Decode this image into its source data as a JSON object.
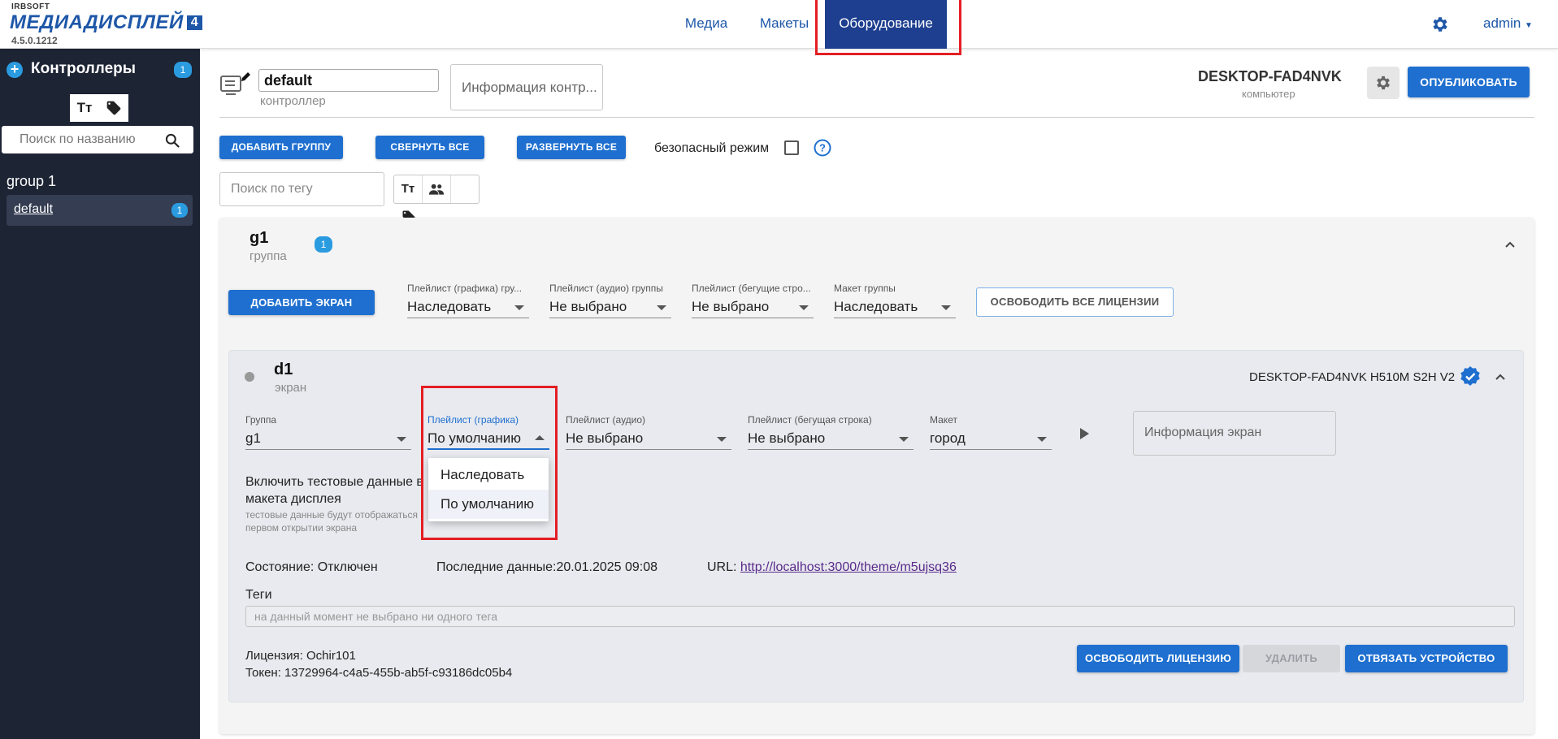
{
  "app": {
    "logo_small": "IRBSOFT",
    "logo_main": "МЕДИАДИСПЛЕЙ",
    "logo_badge": "4",
    "version": "4.5.0.1212"
  },
  "nav": {
    "items": [
      {
        "label": "Медиа"
      },
      {
        "label": "Макеты"
      },
      {
        "label": "Оборудование"
      }
    ],
    "active": "Оборудование",
    "user": "admin"
  },
  "sidebar": {
    "title": "Контроллеры",
    "count": "1",
    "tool_text": "Тт",
    "search_placeholder": "Поиск по названию",
    "group_label": "group 1",
    "items": [
      {
        "label": "default",
        "count": "1"
      }
    ]
  },
  "controller": {
    "name": "default",
    "name_sub": "контроллер",
    "info_label": "Информация контр...",
    "computer_name": "DESKTOP-FAD4NVK",
    "computer_sub": "компьютер",
    "publish_label": "ОПУБЛИКОВАТЬ"
  },
  "toolbar": {
    "add_group": "ДОБАВИТЬ ГРУППУ",
    "collapse_all": "СВЕРНУТЬ ВСЕ",
    "expand_all": "РАЗВЕРНУТЬ ВСЕ",
    "safe_mode": "безопасный режим",
    "tag_search_placeholder": "Поиск по тегу",
    "tag_tool_text": "Тт"
  },
  "group": {
    "title": "g1",
    "sub": "группа",
    "count": "1",
    "add_screen": "ДОБАВИТЬ ЭКРАН",
    "release_all": "ОСВОБОДИТЬ ВСЕ ЛИЦЕНЗИИ",
    "selects": [
      {
        "label": "Плейлист (графика) гру...",
        "value": "Наследовать"
      },
      {
        "label": "Плейлист (аудио) группы",
        "value": "Не выбрано"
      },
      {
        "label": "Плейлист (бегущие стро...",
        "value": "Не выбрано"
      },
      {
        "label": "Макет группы",
        "value": "Наследовать"
      }
    ]
  },
  "screen": {
    "title": "d1",
    "sub": "экран",
    "device": "DESKTOP-FAD4NVK H510M S2H V2",
    "selects": [
      {
        "label": "Группа",
        "value": "g1"
      },
      {
        "label": "Плейлист (графика)",
        "value": "По умолчанию"
      },
      {
        "label": "Плейлист (аудио)",
        "value": "Не выбрано"
      },
      {
        "label": "Плейлист (бегущая строка)",
        "value": "Не выбрано"
      },
      {
        "label": "Макет",
        "value": "город"
      }
    ],
    "info_label": "Информация экран",
    "test_data_line1": "Включить тестовые данные в",
    "test_data_line2": "макета дисплея",
    "test_sub_line1": "тестовые данные будут отображаться",
    "test_sub_line2": "первом открытии экрана",
    "status": "Состояние: Отключен",
    "last_data": "Последние данные:20.01.2025 09:08",
    "url_label": "URL:",
    "url": "http://localhost:3000/theme/m5ujsq36",
    "tags_label": "Теги",
    "tags_empty": "на данный момент не выбрано ни одного тега",
    "license": "Лицензия: Ochir101",
    "token": "Токен: 13729964-c4a5-455b-ab5f-c93186dc05b4",
    "release_license": "ОСВОБОДИТЬ ЛИЦЕНЗИЮ",
    "delete": "УДАЛИТЬ",
    "unbind": "ОТВЯЗАТЬ УСТРОЙСТВО"
  },
  "dropdown": {
    "options": [
      "Наследовать",
      "По умолчанию"
    ],
    "selected": "По умолчанию"
  },
  "colors": {
    "accent": "#1e6fcf",
    "nav_active": "#1e3f8f",
    "sidebar_bg": "#1d2434",
    "badge": "#2b9be0",
    "highlight": "#e31e24"
  }
}
